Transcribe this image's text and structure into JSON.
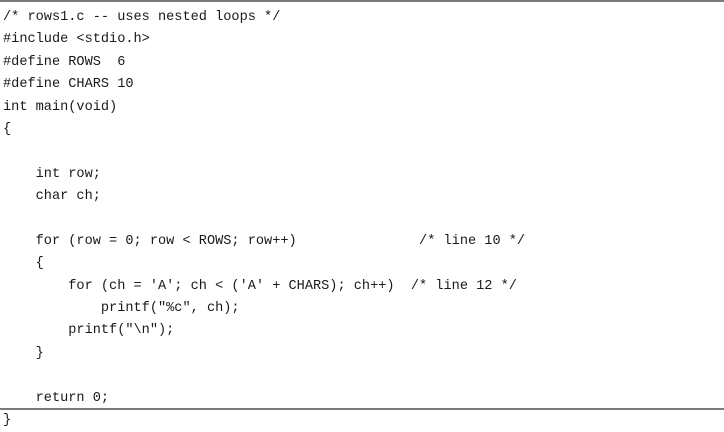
{
  "code": {
    "lines": [
      "/* rows1.c -- uses nested loops */",
      "#include <stdio.h>",
      "#define ROWS  6",
      "#define CHARS 10",
      "int main(void)",
      "{",
      "",
      "    int row;",
      "    char ch;",
      "",
      "    for (row = 0; row < ROWS; row++)               /* line 10 */",
      "    {",
      "        for (ch = 'A'; ch < ('A' + CHARS); ch++)  /* line 12 */",
      "            printf(\"%c\", ch);",
      "        printf(\"\\n\");",
      "    }",
      "",
      "    return 0;",
      "}"
    ]
  }
}
